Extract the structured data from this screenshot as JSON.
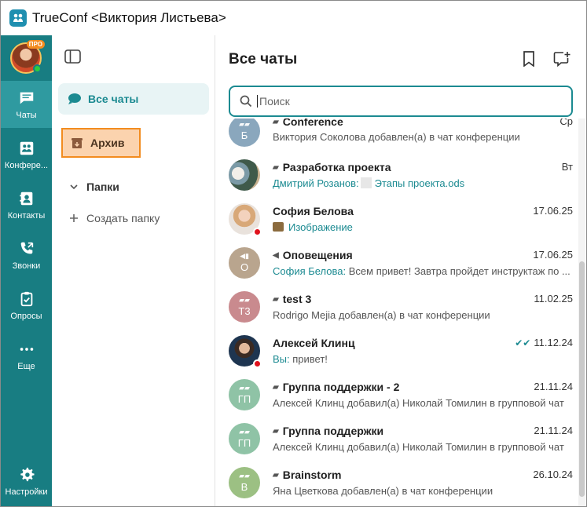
{
  "window": {
    "title": "TrueConf <Виктория Листьева>"
  },
  "rail": {
    "user_badge": "ПРО",
    "items": [
      {
        "label": "Чаты",
        "icon": "chat-icon",
        "active": true
      },
      {
        "label": "Конференции",
        "icon": "conference-icon",
        "active": false
      },
      {
        "label": "Контакты",
        "icon": "contacts-icon",
        "active": false
      },
      {
        "label": "Звонки",
        "icon": "calls-icon",
        "active": false
      },
      {
        "label": "Опросы",
        "icon": "polls-icon",
        "active": false
      },
      {
        "label": "Еще",
        "icon": "more-icon",
        "active": false
      }
    ],
    "settings_label": "Настройки"
  },
  "folders": {
    "all_chats": "Все чаты",
    "archive": "Архив",
    "papki": "Папки",
    "create_folder": "Создать папку"
  },
  "chats": {
    "title": "Все чаты",
    "search_placeholder": "Поиск",
    "items": [
      {
        "name": "Conference",
        "date": "Ср",
        "initials": "Б",
        "preview": "Виктория Соколова добавлен(а) в чат конференции",
        "sender": "",
        "color": "#8aa7bd"
      },
      {
        "name": "Разработка проекта",
        "date": "Вт",
        "initials": "",
        "sender": "Дмитрий Розанов:",
        "preview": "Этапы проекта.ods",
        "color": "#6d8e7c"
      },
      {
        "name": "София Белова",
        "date": "17.06.25",
        "initials": "",
        "sender": "",
        "preview": "Изображение",
        "color": "#d9b39a"
      },
      {
        "name": "Оповещения",
        "date": "17.06.25",
        "initials": "О",
        "sender": "София Белова:",
        "preview": "Всем привет! Завтра пройдет инструктаж по ...",
        "color": "#b9a58e"
      },
      {
        "name": "test 3",
        "date": "11.02.25",
        "initials": "Т3",
        "sender": "",
        "preview": "Rodrigo Mejia добавлен(а) в чат конференции",
        "color": "#c98a8e"
      },
      {
        "name": "Алексей Клинц",
        "date": "11.12.24",
        "initials": "",
        "sender": "Вы:",
        "preview": "привет!",
        "color": "#2a3d57"
      },
      {
        "name": "Группа поддержки - 2",
        "date": "21.11.24",
        "initials": "ГП",
        "sender": "",
        "preview": "Алексей Клинц добавил(а) Николай Томилин в групповой чат",
        "color": "#8fc3a6"
      },
      {
        "name": "Группа поддержки",
        "date": "21.11.24",
        "initials": "ГП",
        "sender": "",
        "preview": "Алексей Клинц добавил(а) Николай Томилин в групповой чат",
        "color": "#8fc3a6"
      },
      {
        "name": "Brainstorm",
        "date": "26.10.24",
        "initials": "B",
        "sender": "",
        "preview": "Яна Цветкова добавлен(а) в чат конференции",
        "color": "#9cc083"
      }
    ]
  },
  "colors": {
    "rail": "#187d82",
    "accent": "#1b8a91",
    "archive_highlight": "#fbd3ae",
    "archive_border": "#f28c1f"
  }
}
